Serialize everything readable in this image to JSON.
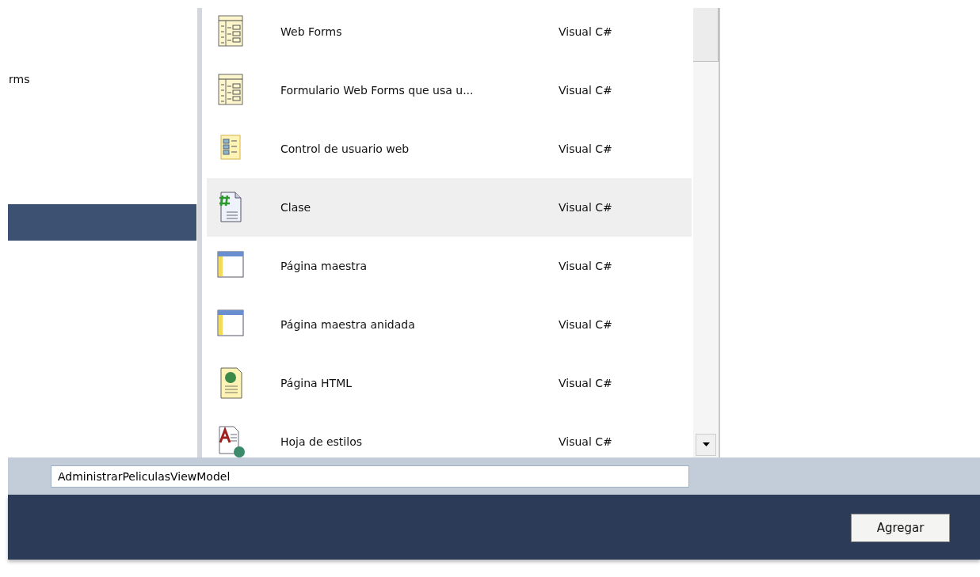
{
  "categories": {
    "items": [
      {
        "label": "rms",
        "selected": false
      },
      {
        "selected": true
      }
    ]
  },
  "templates": {
    "items": [
      {
        "kind": "webform",
        "name": "Web Forms",
        "type": "Visual C#",
        "selected": false
      },
      {
        "kind": "webform",
        "name": "Formulario Web Forms que usa u...",
        "type": "Visual C#",
        "selected": false
      },
      {
        "kind": "usercontrol",
        "name": "Control de usuario web",
        "type": "Visual C#",
        "selected": false
      },
      {
        "kind": "class",
        "name": "Clase",
        "type": "Visual C#",
        "selected": true
      },
      {
        "kind": "masterpage",
        "name": "Página maestra",
        "type": "Visual C#",
        "selected": false
      },
      {
        "kind": "masterpage",
        "name": "Página maestra anidada",
        "type": "Visual C#",
        "selected": false
      },
      {
        "kind": "html",
        "name": "Página HTML",
        "type": "Visual C#",
        "selected": false
      },
      {
        "kind": "stylesheet",
        "name": "Hoja de estilos",
        "type": "Visual C#",
        "selected": false
      }
    ]
  },
  "name_field": {
    "value": "AdministrarPeliculasViewModel"
  },
  "buttons": [
    {
      "label": "Agregar"
    }
  ]
}
